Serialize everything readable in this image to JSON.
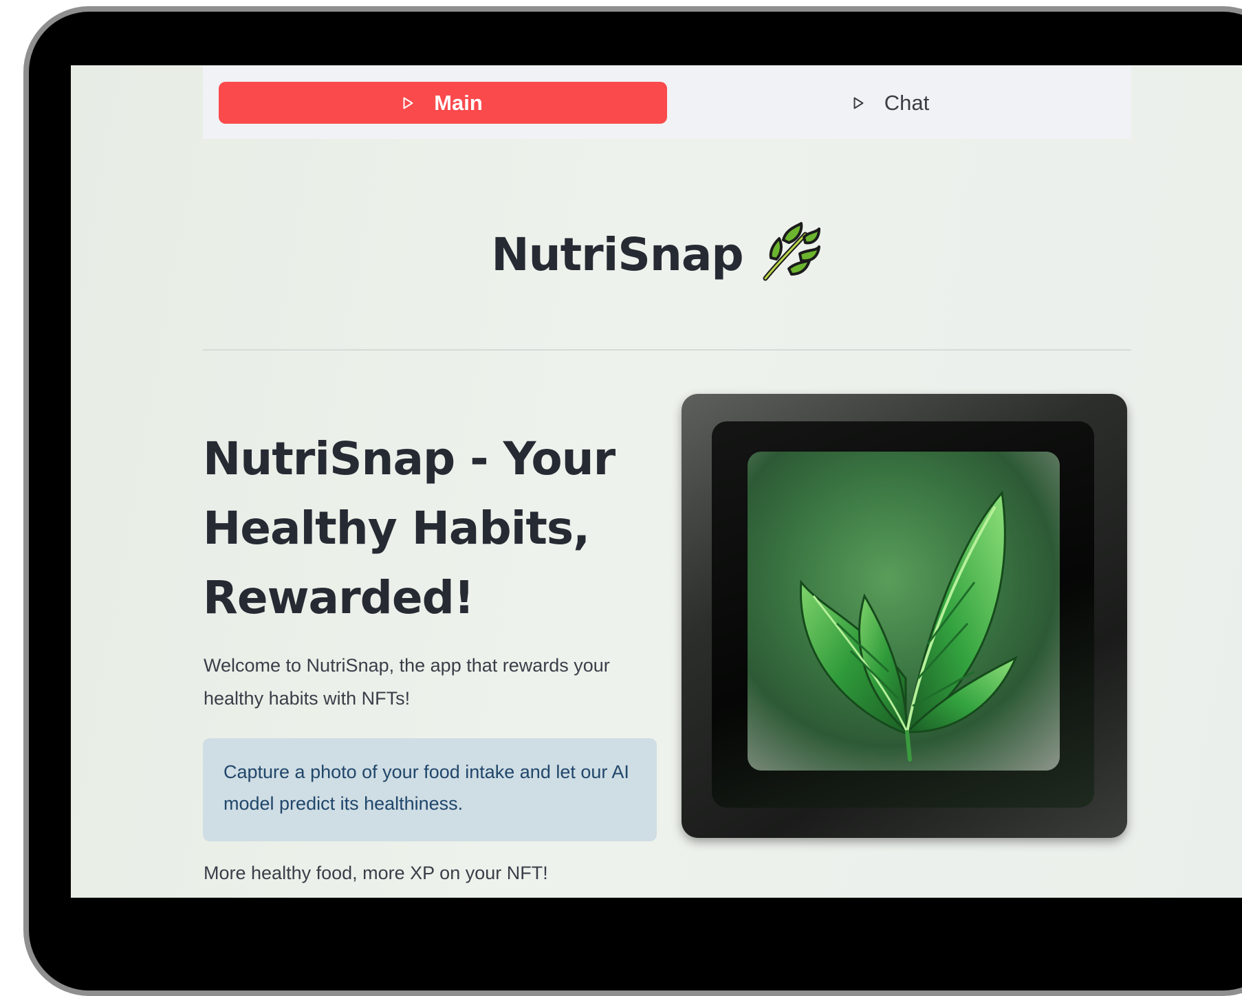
{
  "tabs": [
    {
      "label": "Main",
      "active": true,
      "icon": "play-outline-icon"
    },
    {
      "label": "Chat",
      "active": false,
      "icon": "play-outline-icon"
    }
  ],
  "app": {
    "title": "NutriSnap",
    "title_icon": "herb-icon"
  },
  "hero": {
    "headline": "NutriSnap - Your Healthy Habits, Rewarded!",
    "welcome": "Welcome to NutriSnap, the app that rewards your healthy habits with NFTs!",
    "info": "Capture a photo of your food intake and let our AI model predict its healthiness.",
    "more": "More healthy food, more XP on your NFT!",
    "image_icon": "leaf-app-icon"
  },
  "colors": {
    "accent": "#fb4a4c",
    "info_bg": "#cfdde4",
    "info_text": "#20466a",
    "heading": "#262a33"
  }
}
